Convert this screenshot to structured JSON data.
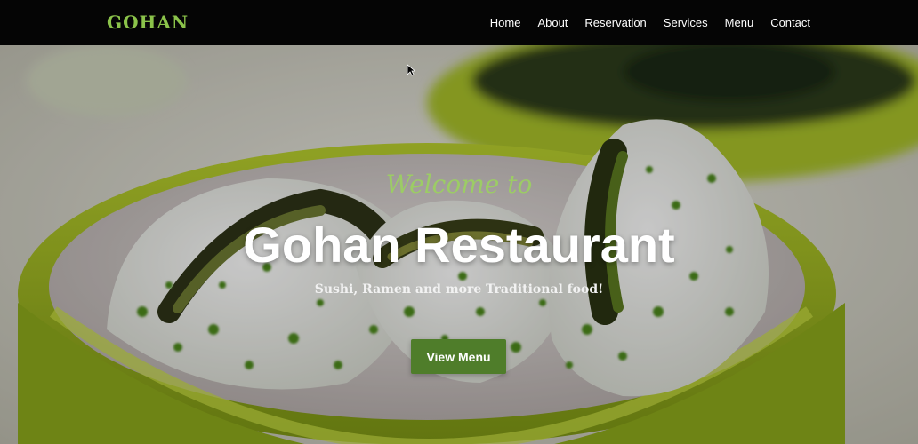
{
  "navbar": {
    "brand": "GOHAN",
    "links": [
      "Home",
      "About",
      "Reservation",
      "Services",
      "Menu",
      "Contact"
    ]
  },
  "hero": {
    "welcome": "Welcome to",
    "title": "Gohan Restaurant",
    "tagline": "Sushi, Ramen and more Traditional food!",
    "cta_label": "View Menu",
    "image": "sushi rolls in green bowl"
  },
  "colors": {
    "brand_green": "#8bc34a",
    "button_green": "#4f7d2a",
    "navbar_bg": "#050505"
  }
}
